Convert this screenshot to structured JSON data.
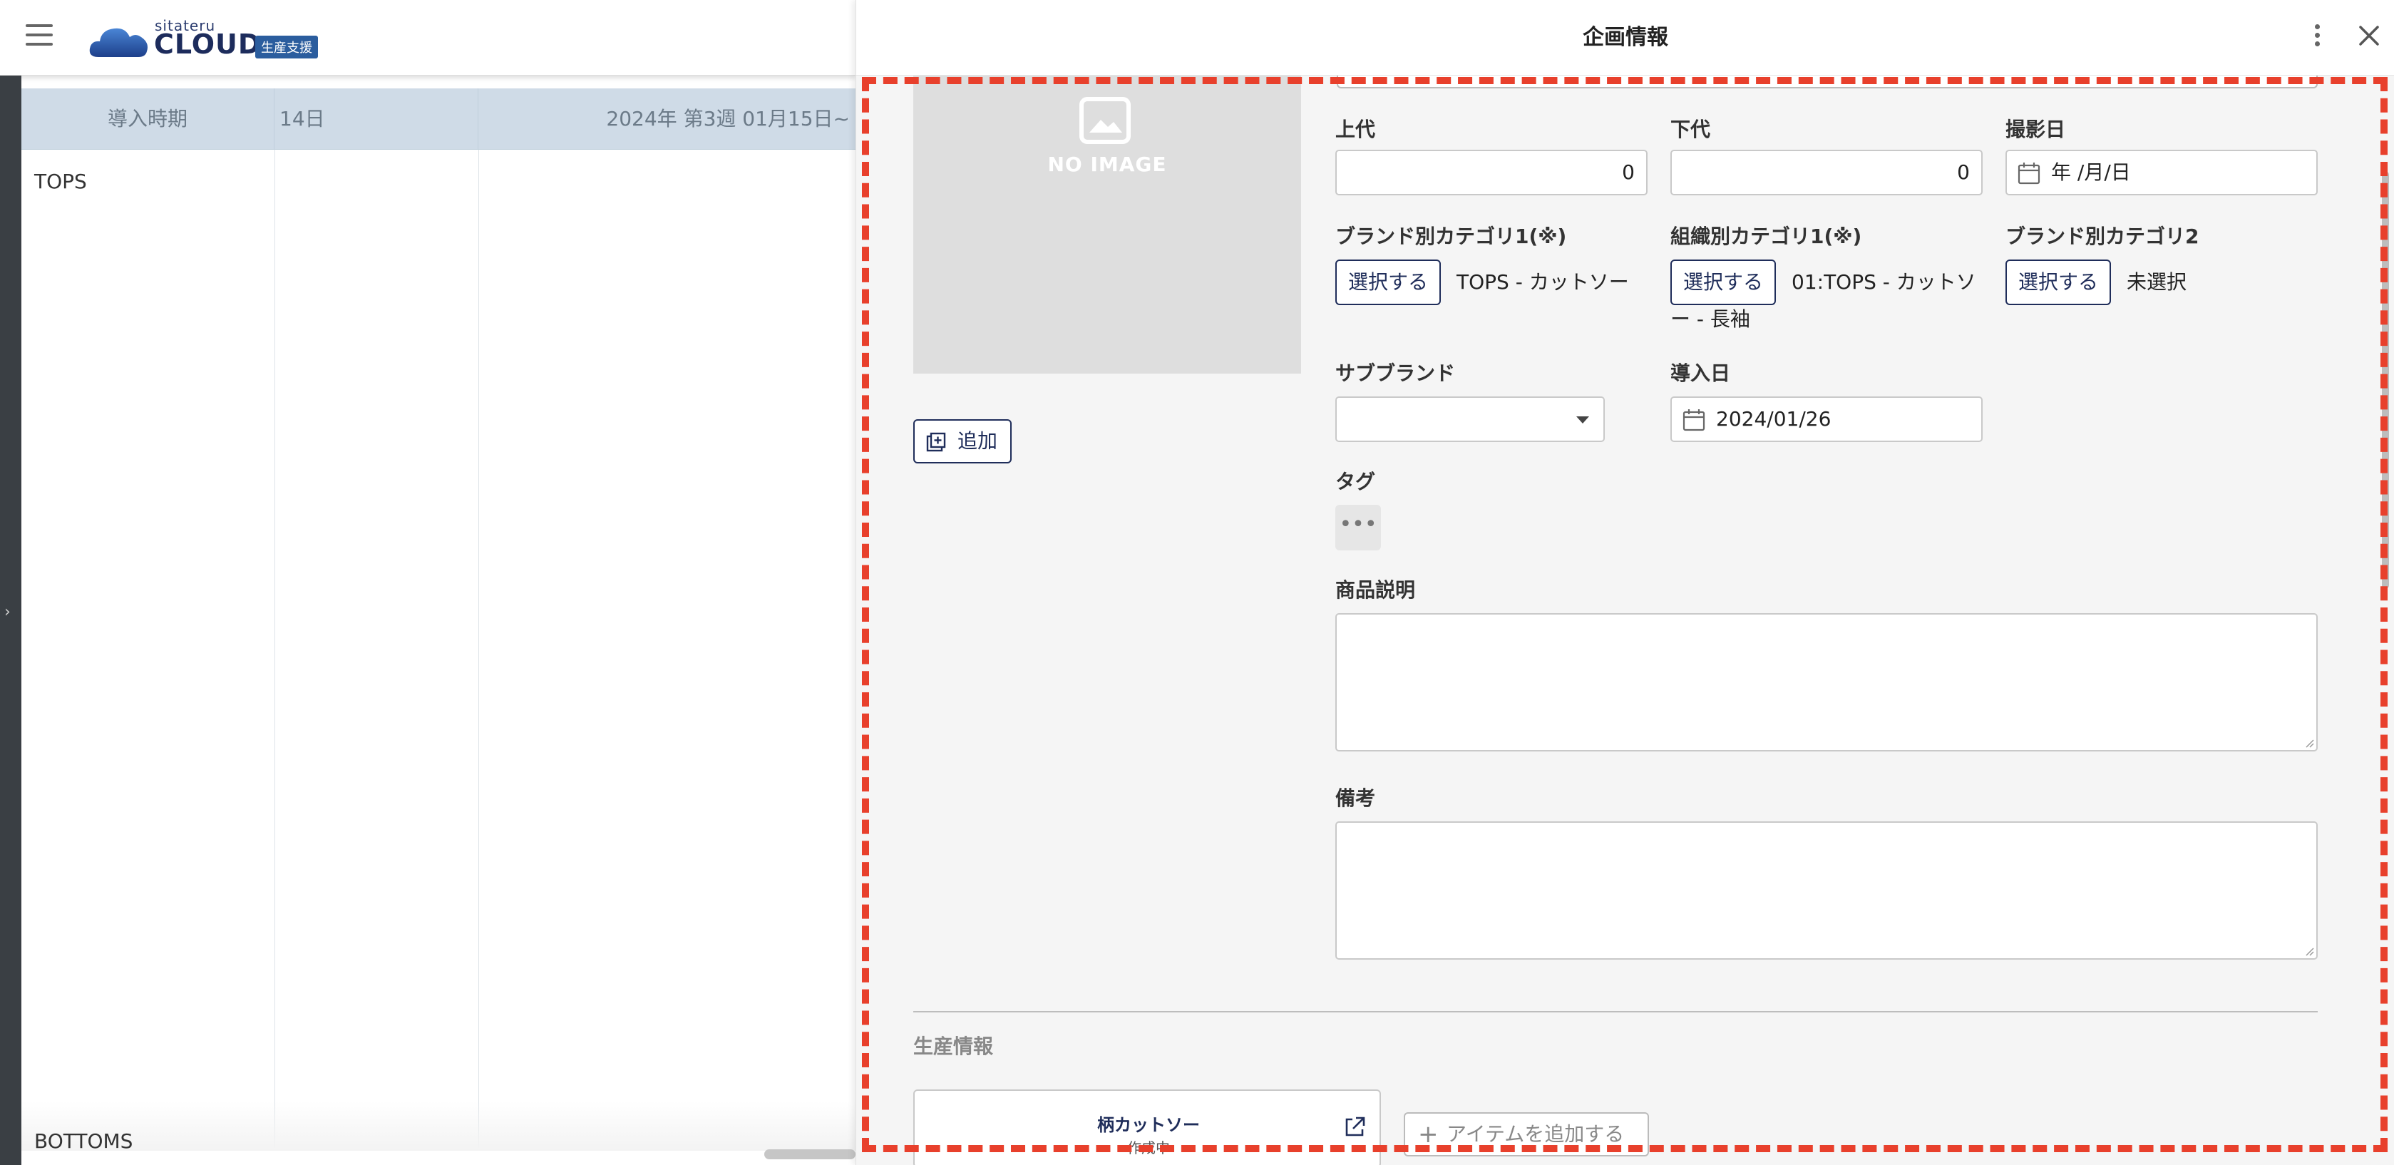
{
  "app": {
    "logo_small": "sitateru",
    "logo_big": "CLOUD",
    "logo_badge": "生産支援"
  },
  "schedule": {
    "col_header": "導入時期",
    "col_day": "14日",
    "col_week": "2024年 第3週 01月15日~",
    "rows": [
      "TOPS",
      "BOTTOMS"
    ]
  },
  "drawer": {
    "title": "企画情報",
    "image_placeholder": "NO IMAGE",
    "add_image_label": "追加",
    "fields": {
      "upper_price_label": "上代",
      "upper_price_value": "0",
      "lower_price_label": "下代",
      "lower_price_value": "0",
      "shoot_date_label": "撮影日",
      "shoot_date_value": "年 /月/日",
      "brand_cat1_label": "ブランド別カテゴリ1(※)",
      "brand_cat1_button": "選択する",
      "brand_cat1_value": "TOPS - カットソー",
      "org_cat1_label": "組織別カテゴリ1(※)",
      "org_cat1_button": "選択する",
      "org_cat1_value_line1": "01:TOPS - カットソ",
      "org_cat1_value_line2": "ー - 長袖",
      "brand_cat2_label": "ブランド別カテゴリ2",
      "brand_cat2_button": "選択する",
      "brand_cat2_value": "未選択",
      "sub_brand_label": "サブブランド",
      "sub_brand_value": "",
      "intro_date_label": "導入日",
      "intro_date_value": "2024/01/26",
      "tag_label": "タグ",
      "tag_more": "•••",
      "description_label": "商品説明",
      "notes_label": "備考"
    },
    "production": {
      "section_title": "生産情報",
      "item_name": "柄カットソー",
      "item_status": "作成中",
      "add_item_label": "アイテムを追加する"
    }
  },
  "colors": {
    "accent": "#1f2d5a",
    "dashed_highlight": "#e8402c",
    "table_header": "#cfdbe7"
  }
}
